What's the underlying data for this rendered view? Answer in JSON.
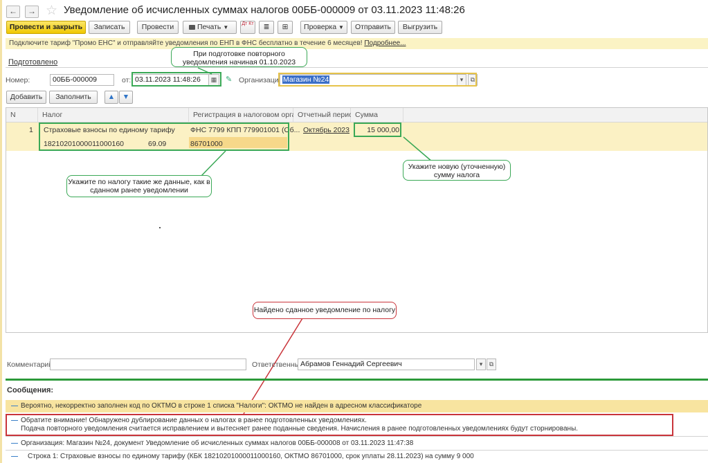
{
  "window": {
    "title": "Уведомление об исчисленных суммах налогов 00ББ-000009 от 03.11.2023 11:48:26"
  },
  "nav": {
    "back_icon": "←",
    "forward_icon": "→",
    "star_icon": "☆"
  },
  "toolbar": {
    "post_close": "Провести и закрыть",
    "save": "Записать",
    "post": "Провести",
    "print": "Печать",
    "check": "Проверка",
    "send": "Отправить",
    "export": "Выгрузить",
    "dt_kt_icon": "Дт Кт"
  },
  "promo": {
    "text": "Подключите тариф \"Промо ЕНС\" и отправляйте уведомления по ЕНП в ФНС бесплатно в течение 6 месяцев!",
    "link": "Подробнее..."
  },
  "status": "Подготовлено",
  "form": {
    "number_label": "Номер:",
    "number_value": "00ББ-000009",
    "date_label": "от:",
    "date_value": "03.11.2023 11:48:26",
    "org_label": "Организация:",
    "org_value": "Магазин №24"
  },
  "table_toolbar": {
    "add": "Добавить",
    "fill": "Заполнить"
  },
  "table": {
    "columns": [
      "N",
      "Налог",
      "Регистрация в налоговом органе",
      "Отчетный период",
      "Сумма"
    ],
    "rows": [
      {
        "n": "1",
        "tax": "Страховые взносы по единому тарифу",
        "kbk": "18210201000011000160",
        "account": "69.09",
        "registration": "ФНС 7799 КПП 779901001 (Об...",
        "oktmo": "86701000",
        "period": "Октябрь 2023",
        "amount": "15 000,00"
      }
    ]
  },
  "annotations": {
    "date_note": "При подготовке повторного уведомления начиная 01.10.2023",
    "tax_note": "Укажите по налогу такие же данные, как в сданном ранее уведомлении",
    "amount_note": "Укажите новую (уточненную) сумму налога",
    "found_note": "Найдено сданное уведомление по налогу"
  },
  "footer": {
    "comment_label": "Комментарий:",
    "comment_value": "",
    "responsible_label": "Ответственный:",
    "responsible_value": "Абрамов Геннадий Сергеевич"
  },
  "messages": {
    "header": "Сообщения:",
    "items": [
      "Вероятно, некорректно заполнен код по ОКТМО в строке 1 списка \"Налоги\": ОКТМО не найден в адресном классификаторе",
      "Обратите внимание! Обнаружено дублирование данных о налогах в ранее подготовленных уведомлениях.",
      "Подача повторного уведомления считается исправлением и вытесняет ранее поданные сведения. Начисления в ранее подготовленных уведомлениях будут сторнированы.",
      "Организация: Магазин №24, документ Уведомление об исчисленных суммах налогов 00ББ-000008 от 03.11.2023 11:47:38",
      "Строка 1: Страховые взносы по единому тарифу (КБК 18210201000011000160, ОКТМО 86701000, срок уплаты 28.11.2023) на сумму 9 000"
    ]
  }
}
